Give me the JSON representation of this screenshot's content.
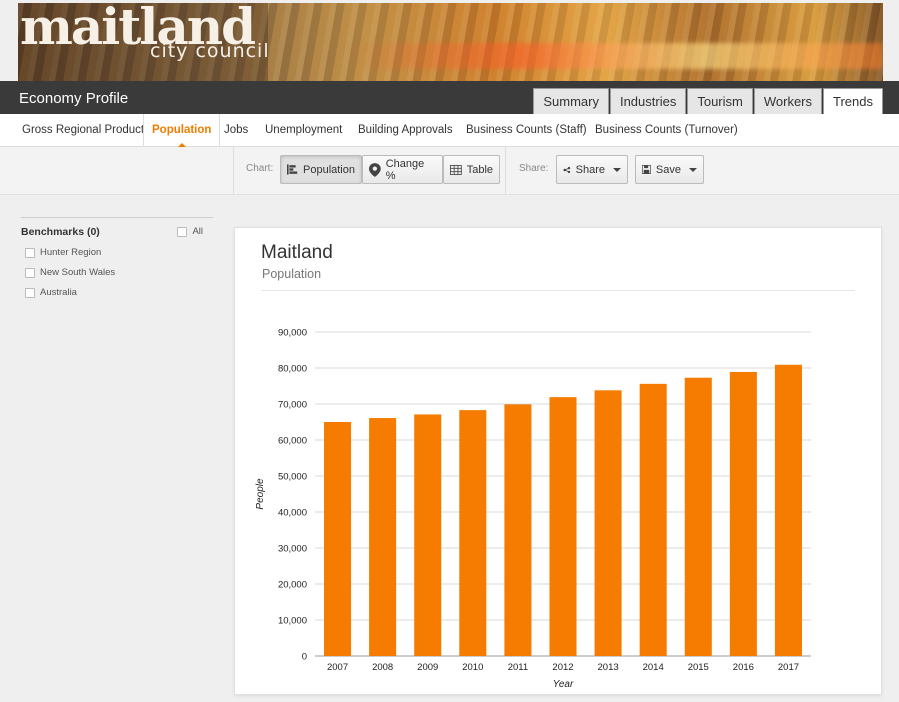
{
  "banner": {
    "logo_main": "maitland",
    "logo_sub": "city council"
  },
  "header": {
    "app_title": "Economy Profile",
    "tabs": [
      {
        "label": "Summary",
        "active": false
      },
      {
        "label": "Industries",
        "active": false
      },
      {
        "label": "Tourism",
        "active": false
      },
      {
        "label": "Workers",
        "active": false
      },
      {
        "label": "Trends",
        "active": true
      }
    ]
  },
  "subnav": {
    "items": [
      {
        "label": "Gross Regional Product",
        "active": false
      },
      {
        "label": "Population",
        "active": true
      },
      {
        "label": "Jobs",
        "active": false
      },
      {
        "label": "Unemployment",
        "active": false
      },
      {
        "label": "Building Approvals",
        "active": false
      },
      {
        "label": "Business Counts (Staff)",
        "active": false
      },
      {
        "label": "Business Counts (Turnover)",
        "active": false
      }
    ]
  },
  "toolbar": {
    "chart_label": "Chart:",
    "chart_buttons": [
      {
        "label": "Population",
        "icon": "bar-chart-icon",
        "active": true
      },
      {
        "label": "Change %",
        "icon": "location-pin-icon",
        "active": false
      },
      {
        "label": "Table",
        "icon": "table-icon",
        "active": false
      }
    ],
    "share_label": "Share:",
    "share_button": "Share",
    "save_button": "Save"
  },
  "benchmarks": {
    "title": "Benchmarks (0)",
    "all_label": "All",
    "items": [
      {
        "label": "Hunter Region",
        "checked": false
      },
      {
        "label": "New South Wales",
        "checked": false
      },
      {
        "label": "Australia",
        "checked": false
      }
    ]
  },
  "card": {
    "title": "Maitland",
    "subtitle": "Population"
  },
  "colors": {
    "accent": "#f07c00",
    "bar": "#f57c00",
    "topbar": "#3a3a3a"
  },
  "chart_data": {
    "type": "bar",
    "categories": [
      "2007",
      "2008",
      "2009",
      "2010",
      "2011",
      "2012",
      "2013",
      "2014",
      "2015",
      "2016",
      "2017"
    ],
    "series": [
      {
        "values": [
          65000,
          66100,
          67100,
          68300,
          69900,
          71900,
          73800,
          75600,
          77300,
          78900,
          80900
        ]
      }
    ],
    "xlabel": "Year",
    "ylabel": "People",
    "ylim": [
      0,
      90000
    ],
    "yticks": [
      "0",
      "10,000",
      "20,000",
      "30,000",
      "40,000",
      "50,000",
      "60,000",
      "70,000",
      "80,000",
      "90,000"
    ],
    "grid": true,
    "legend": "none"
  }
}
